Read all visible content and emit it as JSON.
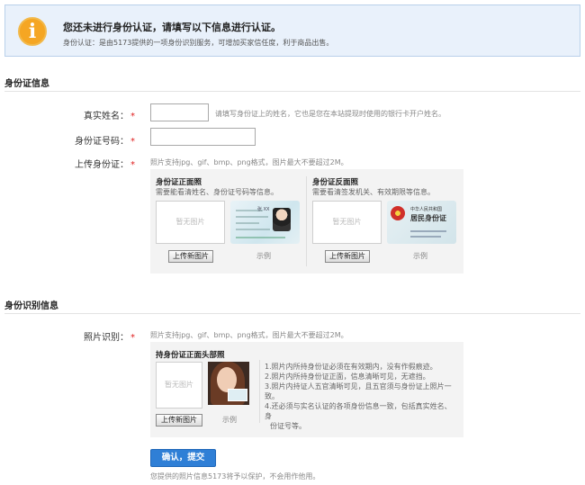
{
  "notice": {
    "title": "您还未进行身份认证，请填写以下信息进行认证。",
    "desc": "身份认证：是由5173提供的一项身份识别服务，可增加买家信任度，利于商品出售。"
  },
  "id_info": {
    "section_title": "身份证信息",
    "name_label": "真实姓名：",
    "name_value": "",
    "name_hint": "请填写身份证上的姓名，它也是您在本站提现时使用的银行卡开户姓名。",
    "idno_label": "身份证号码：",
    "idno_value": "",
    "upload_label": "上传身份证：",
    "upload_hint": "照片支持jpg、gif、bmp、png格式，图片最大不要超过2M。",
    "front": {
      "title": "身份证正面照",
      "desc": "需要能看清姓名、身份证号码等信息。",
      "placeholder": "暂无图片",
      "button": "上传新图片",
      "sample": "示例",
      "sample_name": "张 XX"
    },
    "back": {
      "title": "身份证反面照",
      "desc": "需要看清签发机关、有效期限等信息。",
      "placeholder": "暂无图片",
      "button": "上传新图片",
      "sample": "示例",
      "sample_line1": "中华人民共和国",
      "sample_line2": "居民身份证"
    }
  },
  "photo_info": {
    "section_title": "身份识别信息",
    "photo_label": "照片识别：",
    "photo_hint": "照片支持jpg、gif、bmp、png格式，图片最大不要超过2M。",
    "handheld": {
      "title": "持身份证正面头部照",
      "placeholder": "暂无图片",
      "button": "上传新图片",
      "sample": "示例"
    },
    "rules": [
      "1.照片内所持身份证必须在有效期内，没有作假痕迹。",
      "2.照片内所持身份证正面，信息清晰可见，无遮挡。",
      "3.照片内持证人五官清晰可见，且五官须与身份证上照片一致。",
      "4.还必须与实名认证的各项身份信息一致，包括真实姓名、身",
      "份证号等。"
    ]
  },
  "submit": {
    "label": "确认，提交",
    "note": "您提供的照片信息5173将予以保护，不会用作他用。"
  },
  "colors": {
    "accent": "#2f7fd6",
    "required": "#e02020",
    "notice_bg": "#e9f1fb",
    "warning_icon": "#f5a623"
  }
}
